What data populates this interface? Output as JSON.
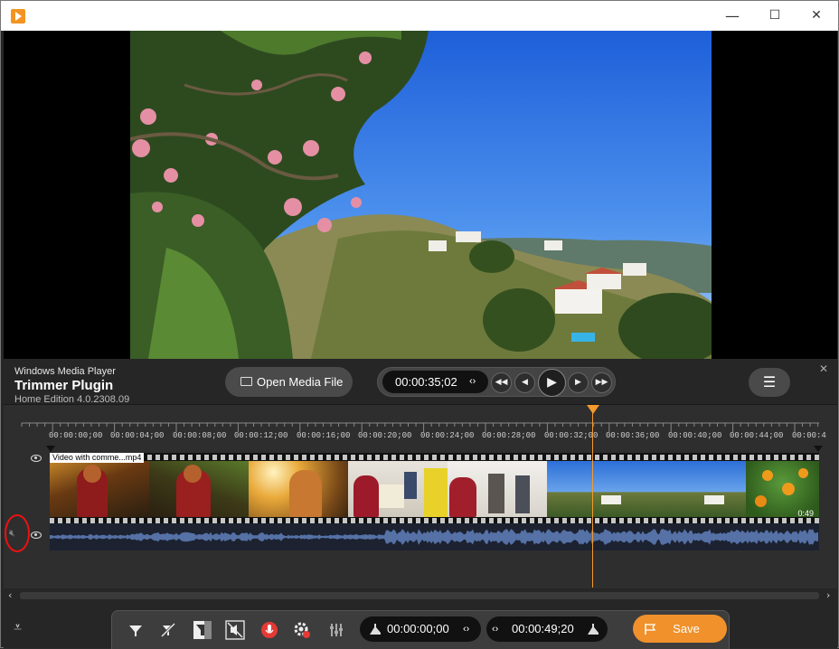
{
  "window": {
    "minimize_glyph": "—",
    "maximize_glyph": "☐",
    "close_glyph": "✕"
  },
  "app_info": {
    "line1": "Windows Media Player",
    "line2": "Trimmer Plugin",
    "line3": "Home Edition 4.0.2308.09"
  },
  "header": {
    "open_label": "Open Media File",
    "current_time": "00:00:35;02",
    "step_glyph": "‹›",
    "menu_glyph": "☰",
    "close_glyph": "✕"
  },
  "transport": {
    "prev_glyph": "◀◀",
    "back_glyph": "◀",
    "play_glyph": "▶",
    "fwd_glyph": "▶",
    "next_glyph": "▶▶"
  },
  "ruler_ticks": [
    "00:00:00;00",
    "00:00:04;00",
    "00:00:08;00",
    "00:00:12;00",
    "00:00:16;00",
    "00:00:20;00",
    "00:00:24;00",
    "00:00:28;00",
    "00:00:32;00",
    "00:00:36;00",
    "00:00:40;00",
    "00:00:44;00",
    "00:00:4"
  ],
  "clip": {
    "name": "Video with comme...mp4",
    "duration": "0:49"
  },
  "scroll": {
    "left": "‹",
    "right": "›"
  },
  "bottom_toolbar": {
    "collapse_glyph": "⩡",
    "start_time": "00:00:00;00",
    "end_time": "00:00:49;20",
    "step_glyph": "‹›",
    "save_label": "Save"
  },
  "colors": {
    "accent": "#f0912c",
    "playhead": "#f59a2d",
    "waveform": "#5571a6",
    "mic": "#e53935",
    "highlight_ring": "#ee1111"
  }
}
